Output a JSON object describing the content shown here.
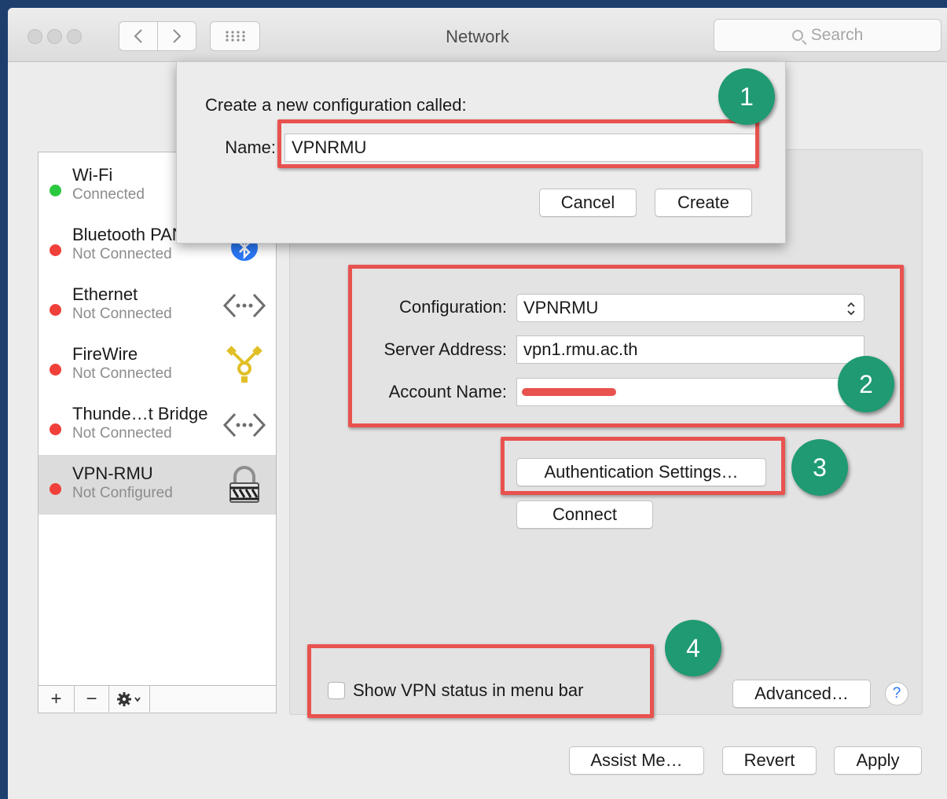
{
  "window": {
    "title": "Network"
  },
  "toolbar": {
    "back_icon": "chevron-left-icon",
    "forward_icon": "chevron-right-icon",
    "grid_icon": "grid-icon",
    "search_placeholder": "Search"
  },
  "services": [
    {
      "name": "Wi-Fi",
      "status": "Connected",
      "status_color": "#2bc840",
      "icon": "wifi-icon"
    },
    {
      "name": "Bluetooth PAN",
      "status": "Not Connected",
      "status_color": "#f0403a",
      "icon": "bluetooth-icon"
    },
    {
      "name": "Ethernet",
      "status": "Not Connected",
      "status_color": "#f0403a",
      "icon": "ethernet-icon"
    },
    {
      "name": "FireWire",
      "status": "Not Connected",
      "status_color": "#f0403a",
      "icon": "firewire-icon"
    },
    {
      "name": "Thunde…t Bridge",
      "status": "Not Connected",
      "status_color": "#f0403a",
      "icon": "ethernet-icon"
    },
    {
      "name": "VPN-RMU",
      "status": "Not Configured",
      "status_color": "#f0403a",
      "icon": "lock-icon",
      "selected": true
    }
  ],
  "sidebar_tools": {
    "add": "+",
    "remove": "−",
    "gear_icon": "gear-icon"
  },
  "dialog": {
    "prompt": "Create a new configuration called:",
    "name_label": "Name:",
    "name_value": "VPNRMU",
    "cancel": "Cancel",
    "create": "Create"
  },
  "vpn": {
    "configuration_label": "Configuration:",
    "configuration_value": "VPNRMU",
    "server_label": "Server Address:",
    "server_value": "vpn1.rmu.ac.th",
    "account_label": "Account Name:",
    "account_value": "",
    "auth_button": "Authentication Settings…",
    "connect_button": "Connect",
    "show_status_label": "Show VPN status in menu bar",
    "advanced_button": "Advanced…",
    "help": "?"
  },
  "footer": {
    "assist": "Assist Me…",
    "revert": "Revert",
    "apply": "Apply"
  },
  "annotations": [
    "1",
    "2",
    "3",
    "4"
  ],
  "colors": {
    "highlight": "#e8524f",
    "badge": "#1f9a73",
    "redaction": "#e8524f"
  }
}
